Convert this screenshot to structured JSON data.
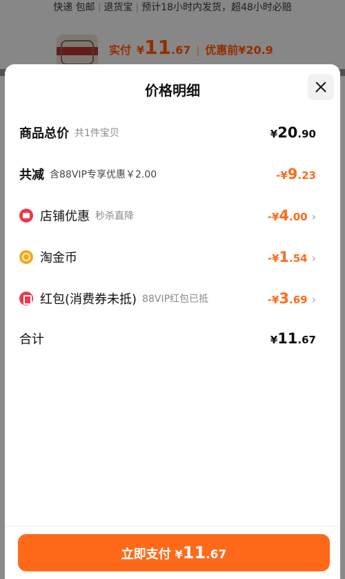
{
  "background": {
    "shipping": [
      "快递 包邮",
      "退货宝",
      "预计18小时内发货，超48小时必赔"
    ],
    "price_label": "实付",
    "price_yen": "¥",
    "price_int": "11",
    "price_dec": ".67",
    "divider": "|",
    "before_label": "优惠前",
    "before_price": "¥20.9"
  },
  "sheet": {
    "title": "价格明细",
    "close_icon": "close-icon",
    "rows": [
      {
        "label": "商品总价",
        "sub": "共1件宝贝",
        "yen": "¥",
        "int": "20",
        "dec": ".90",
        "color": "#111111"
      },
      {
        "label": "共减",
        "sub": "含88VIP专享优惠￥2.00",
        "yen": "-¥",
        "int": "9",
        "dec": ".23",
        "color": "#ff6a1a"
      },
      {
        "label": "店铺优惠",
        "sub": "秒杀直降",
        "icon": "store-icon",
        "yen": "-¥",
        "int": "4",
        "dec": ".00",
        "chevron": "›",
        "color": "#ff6a1a"
      },
      {
        "label": "淘金币",
        "sub": "",
        "icon": "coin-icon",
        "yen": "-¥",
        "int": "1",
        "dec": ".54",
        "chevron": "›",
        "color": "#ff6a1a"
      },
      {
        "label": "红包(消费券未抵)",
        "sub": "88VIP红包已抵",
        "icon": "red-packet-icon",
        "yen": "-¥",
        "int": "3",
        "dec": ".69",
        "chevron": "›",
        "color": "#ff6a1a"
      },
      {
        "label": "合计",
        "sub": "",
        "yen": "¥",
        "int": "11",
        "dec": ".67",
        "color": "#111111"
      }
    ]
  },
  "pay_button": {
    "label": "立即支付",
    "yen": "¥",
    "int": "11",
    "dec": ".67",
    "color": "#ff6a1a"
  }
}
